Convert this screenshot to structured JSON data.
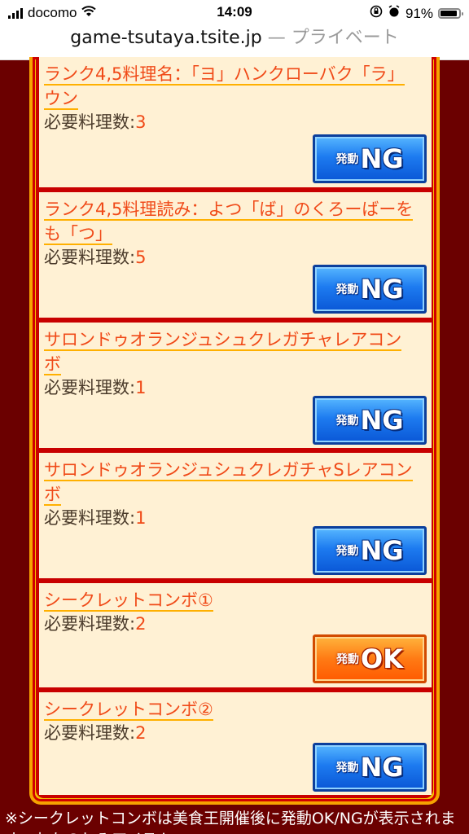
{
  "status_bar": {
    "carrier": "docomo",
    "time": "14:09",
    "battery_percent": "91%",
    "battery_level": 0.91
  },
  "browser": {
    "domain": "game-tsutaya.tsite.jp",
    "private_label": " — プライベート"
  },
  "combos": [
    {
      "title": "ランク4,5料理名：「ヨ」ハンクローバク「ラ」ウン",
      "req_label": "必要料理数:",
      "req_value": "3",
      "button": {
        "state": "ng",
        "kanji": "発動",
        "mark": "NG"
      }
    },
    {
      "title": "ランク4,5料理読み：よつ「ば」のくろーばーをも「つ」",
      "req_label": "必要料理数:",
      "req_value": "5",
      "button": {
        "state": "ng",
        "kanji": "発動",
        "mark": "NG"
      }
    },
    {
      "title": "サロンドゥオランジュシュクレガチャレアコンボ",
      "req_label": "必要料理数:",
      "req_value": "1",
      "button": {
        "state": "ng",
        "kanji": "発動",
        "mark": "NG"
      }
    },
    {
      "title": "サロンドゥオランジュシュクレガチャSレアコンボ",
      "req_label": "必要料理数:",
      "req_value": "1",
      "button": {
        "state": "ng",
        "kanji": "発動",
        "mark": "NG"
      }
    },
    {
      "title": "シークレットコンボ①",
      "req_label": "必要料理数:",
      "req_value": "2",
      "button": {
        "state": "ok",
        "kanji": "発動",
        "mark": "OK"
      }
    },
    {
      "title": "シークレットコンボ②",
      "req_label": "必要料理数:",
      "req_value": "2",
      "button": {
        "state": "ng",
        "kanji": "発動",
        "mark": "NG"
      }
    }
  ],
  "footnote": "※シークレットコンボは美食王開催後に発動OK/NGが表示されます。おたのしみアイテム",
  "colors": {
    "title": "#f04a18",
    "ng_button": "#1d7bf0",
    "ok_button": "#ff7a14",
    "page_background": "#6b0000"
  }
}
